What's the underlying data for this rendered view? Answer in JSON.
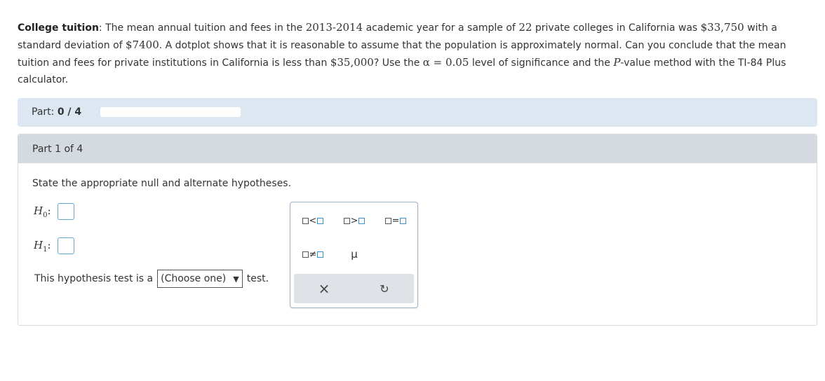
{
  "problem": {
    "title": "College tuition",
    "t1": ": The mean annual tuition and fees in the ",
    "year": "2013-2014",
    "t2": " academic year for a sample of ",
    "n": "22",
    "t3": " private colleges in California was ",
    "mean": "$33,750",
    "t4": " with a standard deviation of ",
    "sd": "$7400",
    "t5": ". A dotplot shows that it is reasonable to assume that the population is approximately normal. Can you conclude that the mean tuition and fees for private institutions in California is less than ",
    "target": "$35,000",
    "t6": "? Use the ",
    "alpha": "α = 0.05",
    "t7": " level of significance and the ",
    "p": "P",
    "t8": "-value method with the TI-84 Plus calculator."
  },
  "part_bar": {
    "label": "Part: ",
    "progress_text": "0 / 4",
    "progress_fraction": 0
  },
  "part": {
    "header": "Part 1 of 4",
    "instruction": "State the appropriate null and alternate hypotheses.",
    "h0_label": "H",
    "h0_sub": "0",
    "h1_label": "H",
    "h1_sub": "1",
    "colon": ":",
    "test_prefix": "This hypothesis test is a",
    "select_value": "(Choose one)",
    "select_arrow": "▼",
    "test_suffix": "test."
  },
  "palette": {
    "lt": "<",
    "gt": ">",
    "eq": "=",
    "neq": "≠",
    "mu": "μ",
    "clear_icon": "×",
    "undo_icon": "↻"
  }
}
